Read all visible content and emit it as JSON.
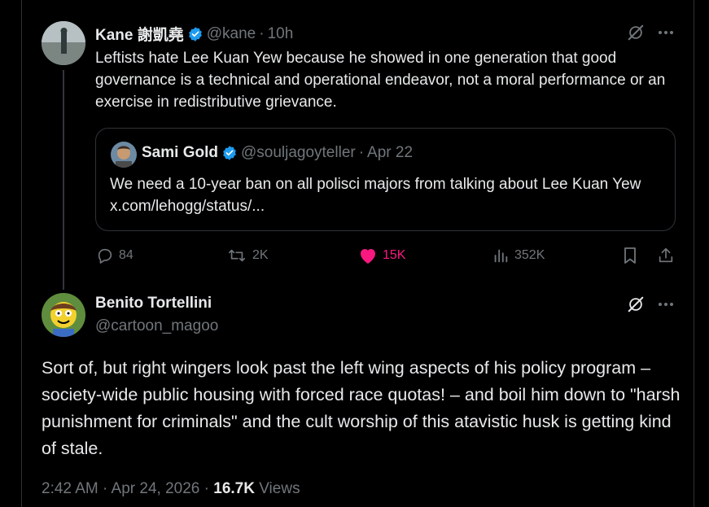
{
  "colors": {
    "background": "#000000",
    "text": "#e7e9ea",
    "muted": "#71767b",
    "verified": "#1d9bf0",
    "like": "#f91880",
    "border": "#2f3336"
  },
  "parent_post": {
    "author_name": "Kane 謝凱堯",
    "handle": "@kane",
    "separator": "·",
    "time": "10h",
    "text": "Leftists hate Lee Kuan Yew because he showed in one generation that good governance is a technical and operational endeavor, not a moral performance or an exercise in redistributive grievance.",
    "quote": {
      "author_name": "Sami Gold",
      "handle": "@souljagoyteller",
      "separator": "·",
      "date": "Apr 22",
      "text": "We need a 10-year ban on all polisci majors from talking about Lee Kuan Yew x.com/lehogg/status/..."
    },
    "actions": {
      "replies": "84",
      "reposts": "2K",
      "likes": "15K",
      "views": "352K"
    }
  },
  "main_post": {
    "author_name": "Benito Tortellini",
    "handle": "@cartoon_magoo",
    "text": "Sort of, but right wingers look past the left wing aspects of his policy program – society-wide public housing with forced race quotas! – and boil him down to \"harsh punishment for criminals\" and the cult worship of this atavistic husk is getting kind of stale.",
    "timestamp": "2:42 AM · Apr 24, 2026 · ",
    "views_count": "16.7K",
    "views_label": " Views"
  },
  "icons": {
    "grok": "grok-icon",
    "more": "more-icon",
    "reply": "reply-icon",
    "repost": "repost-icon",
    "like": "heart-icon",
    "views": "analytics-icon",
    "bookmark": "bookmark-icon",
    "share": "share-icon",
    "verified": "verified-badge-icon"
  }
}
